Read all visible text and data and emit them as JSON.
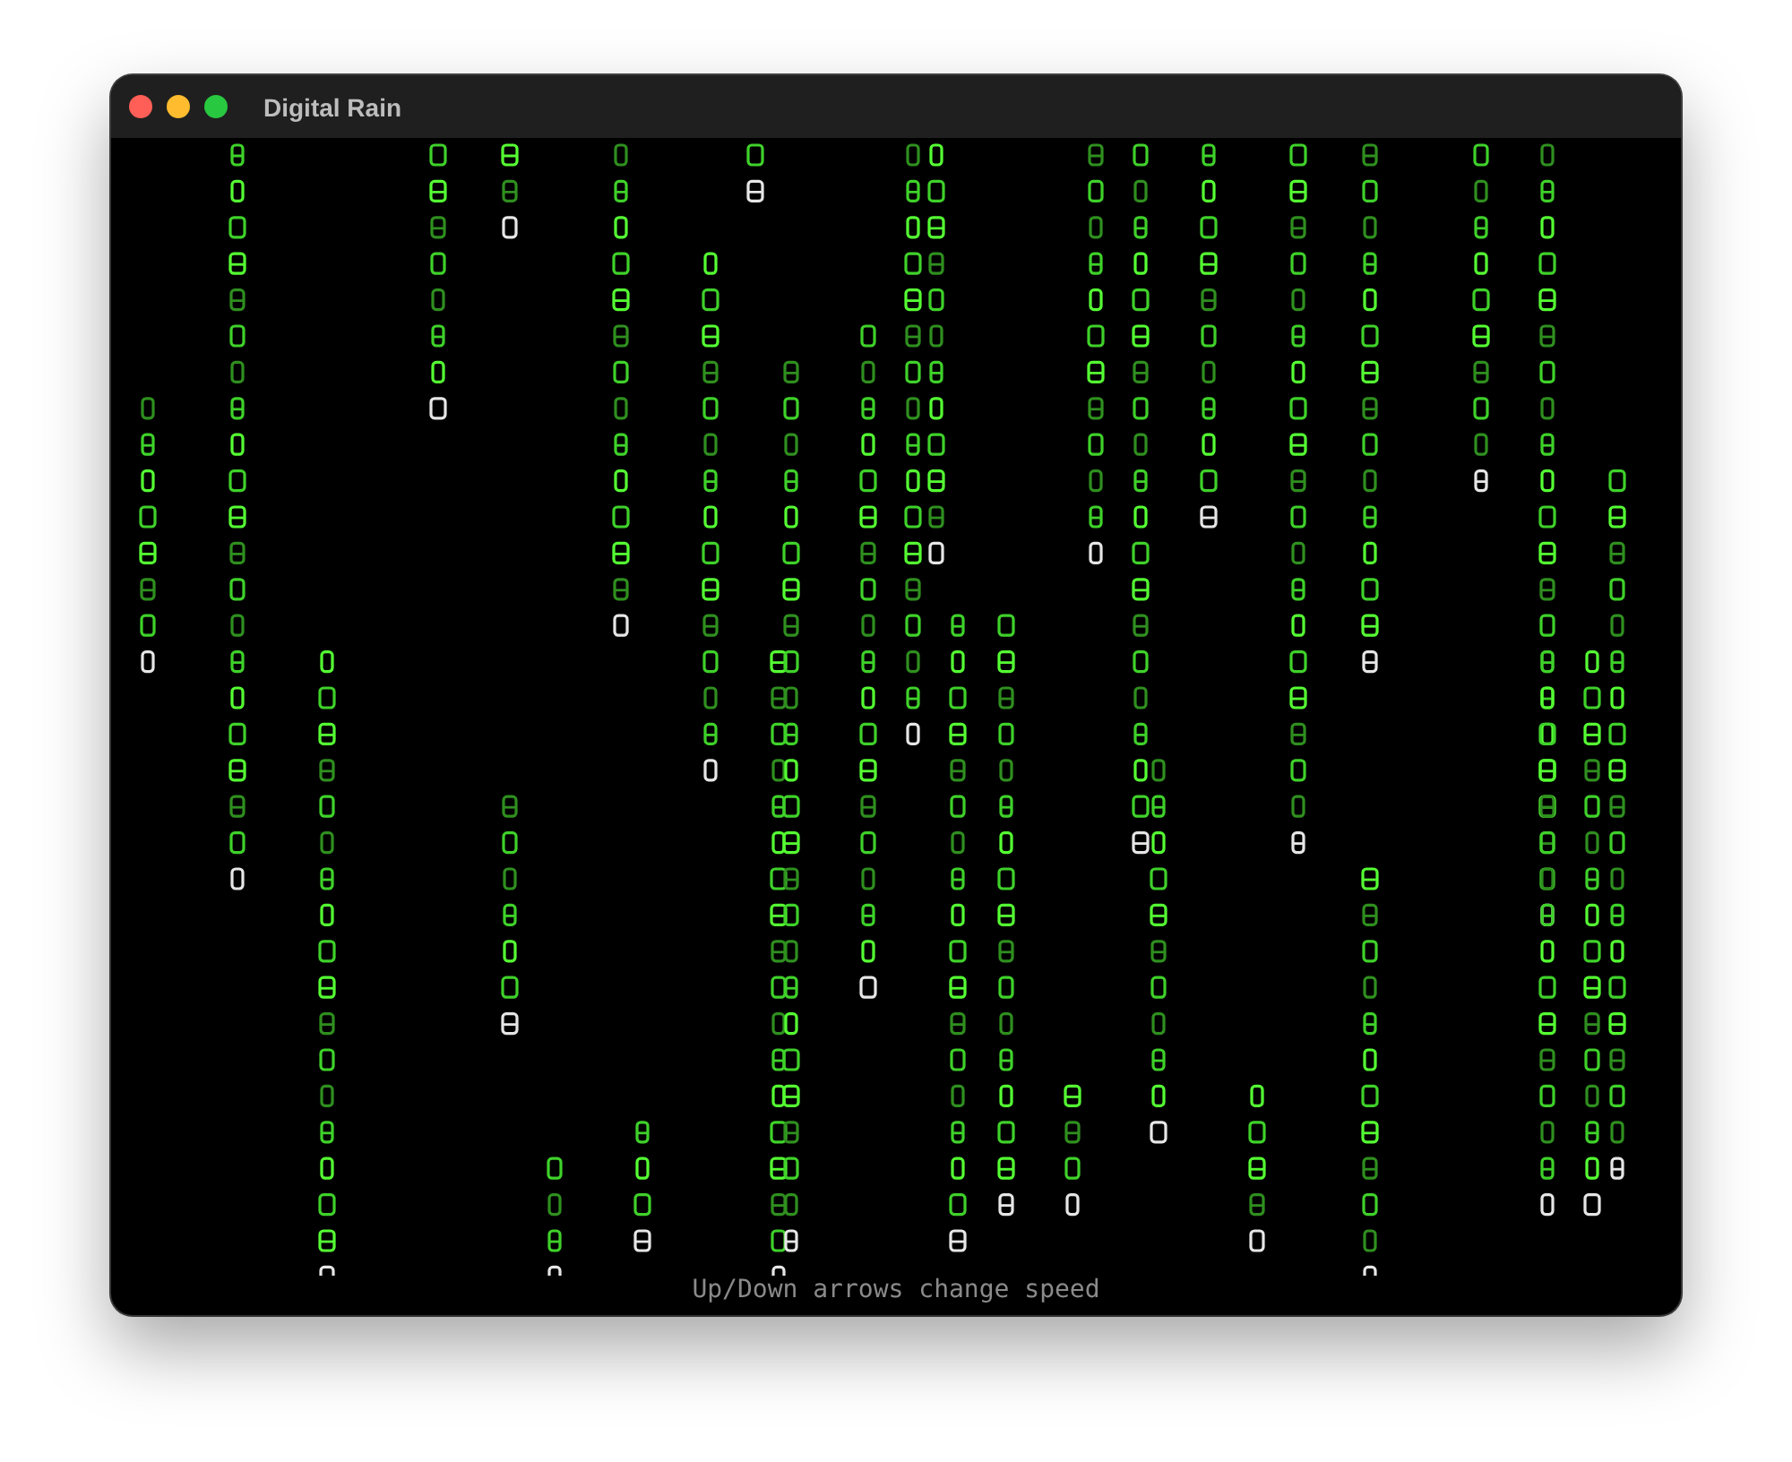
{
  "window": {
    "title": "Digital Rain"
  },
  "footer_hint": "Up/Down arrows change speed"
}
